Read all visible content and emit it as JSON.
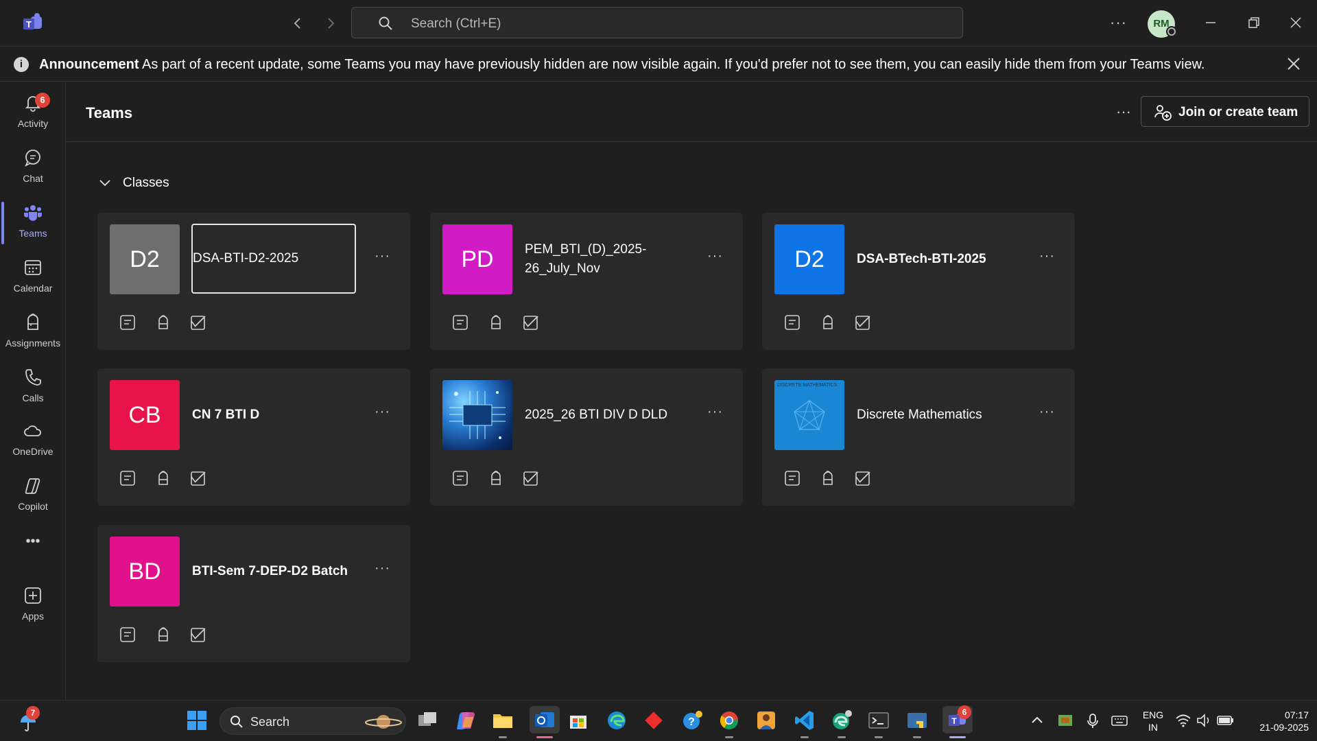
{
  "titlebar": {
    "search_placeholder": "Search (Ctrl+E)",
    "avatar_initials": "RM",
    "more_label": "···"
  },
  "announcement": {
    "bold": "Announcement",
    "text": "As part of a recent update, some Teams you may have previously hidden are now visible again. If you'd prefer not to see them, you can easily hide them from your Teams view."
  },
  "rail": {
    "items": [
      {
        "label": "Activity",
        "badge": "6",
        "icon": "bell-icon"
      },
      {
        "label": "Chat",
        "icon": "chat-icon"
      },
      {
        "label": "Teams",
        "icon": "teams-icon",
        "active": true
      },
      {
        "label": "Calendar",
        "icon": "calendar-icon"
      },
      {
        "label": "Assignments",
        "icon": "backpack-icon"
      },
      {
        "label": "Calls",
        "icon": "phone-icon"
      },
      {
        "label": "OneDrive",
        "icon": "cloud-icon"
      },
      {
        "label": "Copilot",
        "icon": "copilot-icon"
      },
      {
        "label": "Apps",
        "icon": "add-apps-icon"
      }
    ],
    "more_label": "•••"
  },
  "main": {
    "title": "Teams",
    "more_label": "···",
    "join_button": "Join or create team",
    "section_label": "Classes",
    "cards": [
      {
        "initials": "D2",
        "name": "DSA-BTI-D2-2025",
        "color": "#6e6e6e",
        "bold": false,
        "focused": true
      },
      {
        "initials": "PD",
        "name": "PEM_BTI_(D)_2025-26_July_Nov",
        "color": "#d11cc6",
        "bold": false
      },
      {
        "initials": "D2",
        "name": "DSA-BTech-BTI-2025",
        "color": "#0f74e6",
        "bold": true
      },
      {
        "initials": "CB",
        "name": "CN 7 BTI D",
        "color": "#e8134a",
        "bold": true
      },
      {
        "initials": "",
        "name": "2025_26 BTI DIV D DLD",
        "color": "#1e5aa8",
        "bold": false,
        "image": "circuit-image"
      },
      {
        "initials": "",
        "name": "Discrete Mathematics",
        "color": "#1987d4",
        "bold": false,
        "image": "discrete-math-image",
        "image_caption": "DISCRETE MATHEMATICS"
      },
      {
        "initials": "BD",
        "name": "BTI-Sem 7-DEP-D2 Batch",
        "color": "#e0118a",
        "bold": true
      }
    ],
    "card_more": "···"
  },
  "taskbar": {
    "weather_badge": "7",
    "search_label": "Search",
    "teams_badge": "6",
    "lang_line1": "ENG",
    "lang_line2": "IN",
    "time": "07:17",
    "date": "21-09-2025"
  },
  "colors": {
    "accent": "#7f85f5",
    "background": "#1f1f1f",
    "card": "#292929",
    "badge": "#e0423a"
  }
}
